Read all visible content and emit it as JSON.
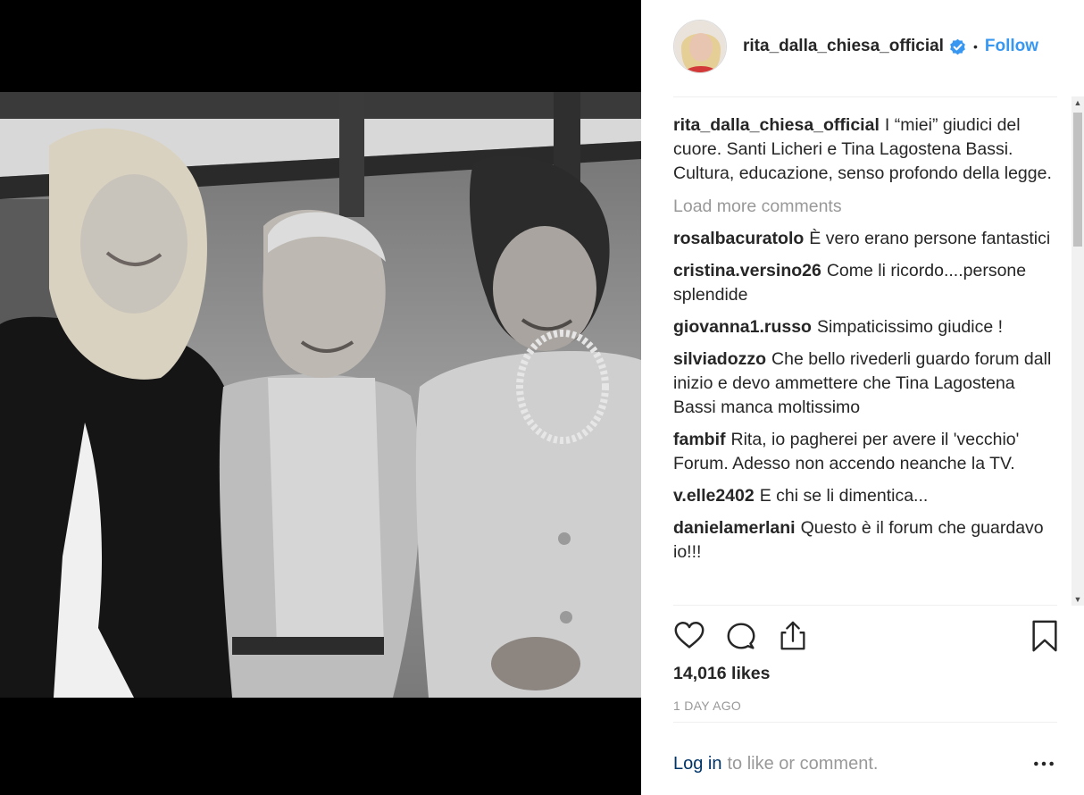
{
  "post": {
    "username": "rita_dalla_chiesa_official",
    "separator": "•",
    "follow_label": "Follow",
    "icons": {
      "verified": "verified-badge-icon",
      "like": "heart-icon",
      "comment": "speech-bubble-icon",
      "share": "share-arrow-icon",
      "save": "bookmark-icon",
      "more": "ellipsis-icon"
    },
    "colors": {
      "link": "#3897f0",
      "login": "#003569",
      "muted": "#999999",
      "text": "#262626"
    }
  },
  "caption": {
    "username": "rita_dalla_chiesa_official",
    "text": "I “miei” giudici del cuore. Santi Licheri e Tina Lagostena Bassi. Cultura, educazione, senso profondo della legge."
  },
  "load_more_label": "Load more comments",
  "comments": [
    {
      "username": "rosalbacuratolo",
      "text": "È vero erano persone fantastici"
    },
    {
      "username": "cristina.versino26",
      "text": "Come li ricordo....persone splendide"
    },
    {
      "username": "giovanna1.russo",
      "text": "Simpaticissimo giudice !"
    },
    {
      "username": "silviadozzo",
      "text": "Che bello rivederli guardo forum dall inizio e devo ammettere che Tina Lagostena Bassi manca moltissimo"
    },
    {
      "username": "fambif",
      "text": "Rita, io pagherei per avere il 'vecchio' Forum. Adesso non accendo neanche la TV."
    },
    {
      "username": "v.elle2402",
      "text": "E chi se li dimentica..."
    },
    {
      "username": "danielamerlani",
      "text": "Questo è il forum che guardavo io!!!"
    }
  ],
  "likes_label": "14,016 likes",
  "timestamp": "1 DAY AGO",
  "footer": {
    "login_label": "Log in",
    "login_suffix": "to like or comment."
  }
}
